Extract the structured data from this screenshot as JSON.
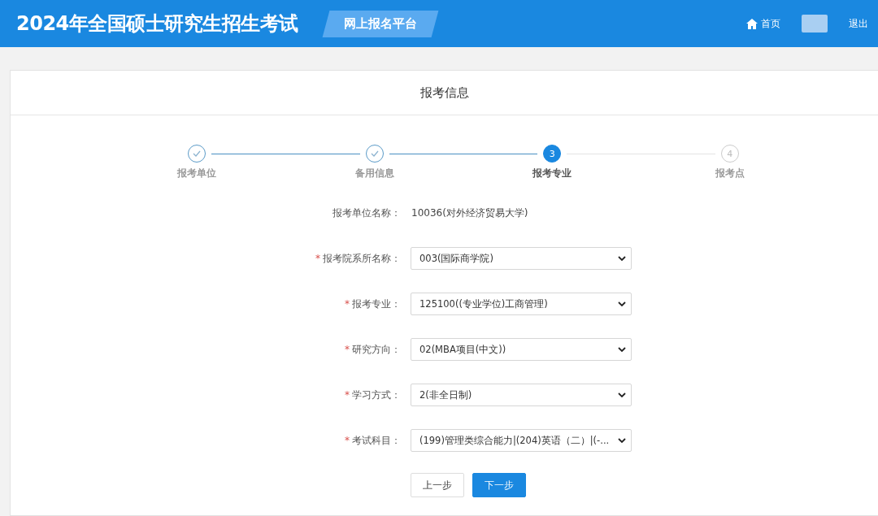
{
  "header": {
    "title": "2024年全国硕士研究生招生考试",
    "platform_tag": "网上报名平台",
    "nav": [
      {
        "kind": "home",
        "label": "首页"
      },
      {
        "kind": "avatar"
      },
      {
        "kind": "logout",
        "label": "退出"
      }
    ]
  },
  "card": {
    "title": "报考信息"
  },
  "steps": [
    {
      "label": "报考单位",
      "completed": true,
      "selected": false
    },
    {
      "label": "备用信息",
      "completed": true,
      "selected": false
    },
    {
      "label": "报考专业",
      "completed": false,
      "selected": true,
      "number": "3"
    },
    {
      "label": "报考点",
      "completed": false,
      "selected": false,
      "number": "4"
    }
  ],
  "form": [
    {
      "kind": "text",
      "label": "报考单位名称：",
      "value": "10036(对外经济贸易大学)"
    },
    {
      "kind": "select",
      "required_mark": "*",
      "label": "报考院系所名称：",
      "value": "003(国际商学院)"
    },
    {
      "kind": "select",
      "required_mark": "*",
      "label": "报考专业：",
      "value": "125100((专业学位)工商管理)"
    },
    {
      "kind": "select",
      "required_mark": "*",
      "label": "研究方向：",
      "value": "02(MBA项目(中文))"
    },
    {
      "kind": "select",
      "required_mark": "*",
      "label": "学习方式：",
      "value": "2(非全日制)"
    },
    {
      "kind": "select",
      "required_mark": "*",
      "label": "考试科目：",
      "value": "(199)管理类综合能力|(204)英语（二）|(-..."
    }
  ],
  "buttons": [
    {
      "label": "上一步",
      "primary": false
    },
    {
      "label": "下一步",
      "primary": true
    }
  ]
}
